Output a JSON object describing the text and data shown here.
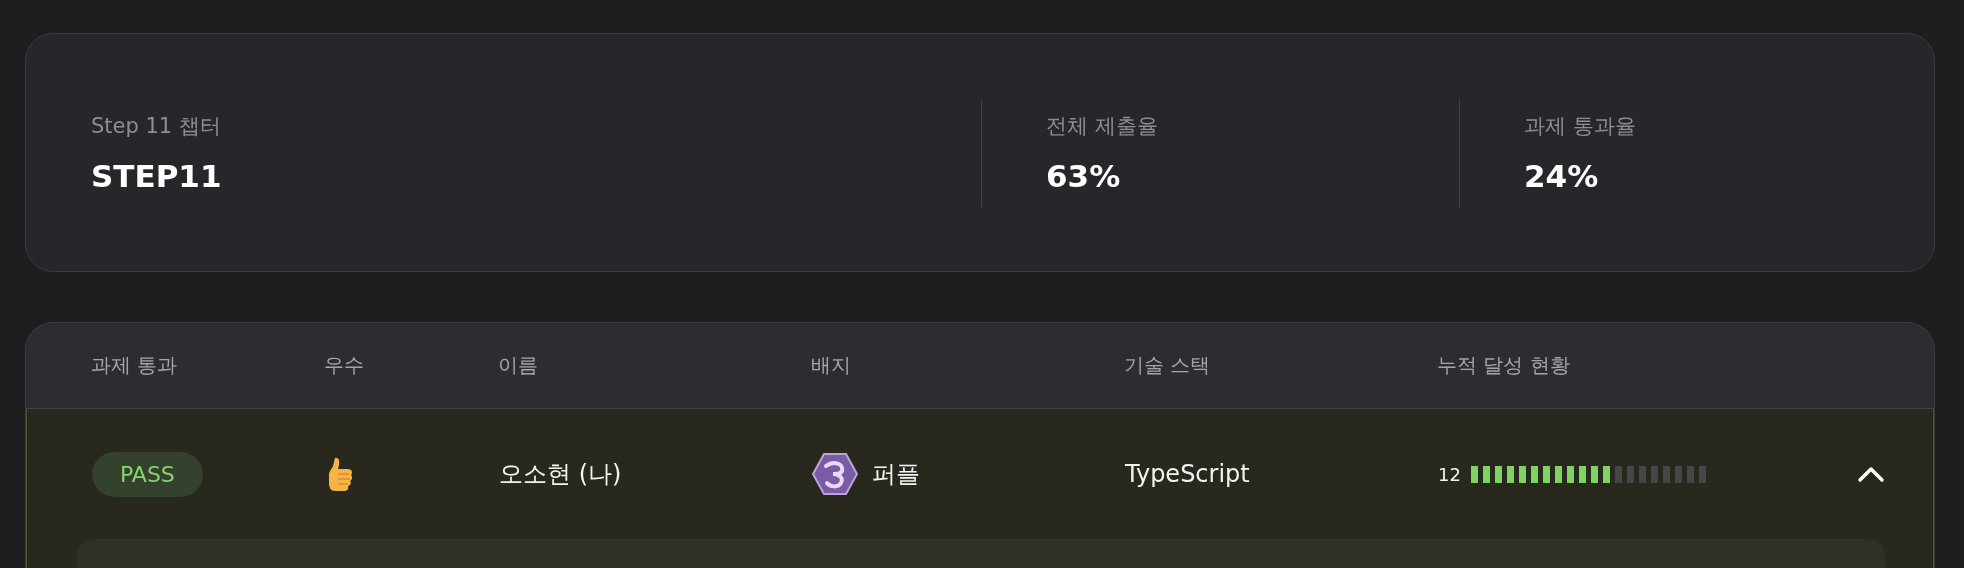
{
  "summary": [
    {
      "label": "Step 11 챕터",
      "value": "STEP11"
    },
    {
      "label": "전체 제출율",
      "value": "63%"
    },
    {
      "label": "과제 통과율",
      "value": "24%"
    }
  ],
  "table": {
    "columns": [
      "과제 통과",
      "우수",
      "이름",
      "배지",
      "기술 스택",
      "누적 달성 현황"
    ],
    "rows": [
      {
        "status": "PASS",
        "passed": true,
        "excellent": true,
        "name": "오소현 (나)",
        "badge": "퍼플",
        "stack": "TypeScript",
        "count": "12",
        "level": 0.6,
        "expanded": true
      }
    ]
  }
}
